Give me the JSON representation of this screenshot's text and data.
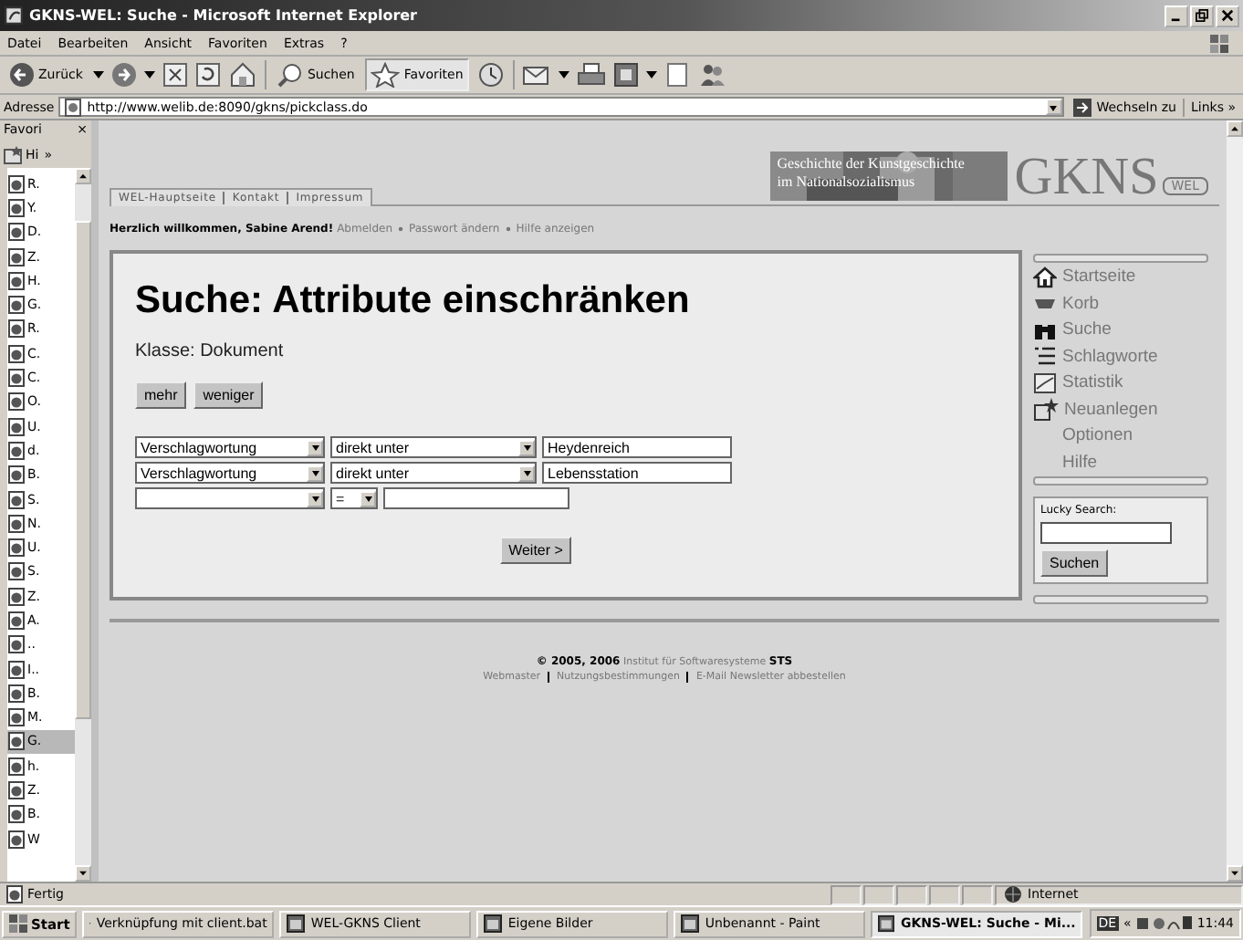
{
  "window": {
    "title": "GKNS-WEL: Suche - Microsoft Internet Explorer"
  },
  "menu": [
    "Datei",
    "Bearbeiten",
    "Ansicht",
    "Favoriten",
    "Extras",
    "?"
  ],
  "toolbar": {
    "back": "Zurück",
    "search": "Suchen",
    "favorites": "Favoriten"
  },
  "address": {
    "label": "Adresse",
    "url": "http://www.welib.de:8090/gkns/pickclass.do",
    "go": "Wechseln zu",
    "links": "Links »"
  },
  "favorites": {
    "title": "Favori",
    "close": "×",
    "add": "Hi",
    "more": "»",
    "items": [
      {
        "label": "R.",
        "selected": false
      },
      {
        "label": "Y.",
        "selected": false
      },
      {
        "label": "D.",
        "selected": false
      },
      {
        "label": "Z.",
        "selected": false
      },
      {
        "label": "H.",
        "selected": false
      },
      {
        "label": "G.",
        "selected": false
      },
      {
        "label": "R.",
        "selected": false
      },
      {
        "label": "C.",
        "selected": false
      },
      {
        "label": "C.",
        "selected": false
      },
      {
        "label": "O.",
        "selected": false
      },
      {
        "label": "U.",
        "selected": false
      },
      {
        "label": "d.",
        "selected": false
      },
      {
        "label": "B.",
        "selected": false
      },
      {
        "label": "S.",
        "selected": false
      },
      {
        "label": "N.",
        "selected": false
      },
      {
        "label": "U.",
        "selected": false
      },
      {
        "label": "S.",
        "selected": false
      },
      {
        "label": "Z.",
        "selected": false
      },
      {
        "label": "A.",
        "selected": false
      },
      {
        "label": "..",
        "selected": false
      },
      {
        "label": "I..",
        "selected": false
      },
      {
        "label": "B.",
        "selected": false
      },
      {
        "label": "M.",
        "selected": false
      },
      {
        "label": "G.",
        "selected": true
      },
      {
        "label": "h.",
        "selected": false
      },
      {
        "label": "Z.",
        "selected": false
      },
      {
        "label": "B.",
        "selected": false
      },
      {
        "label": "W",
        "selected": false
      }
    ]
  },
  "page": {
    "nav": [
      "WEL-Hauptseite",
      "Kontakt",
      "Impressum"
    ],
    "banner": [
      "Geschichte der Kunstgeschichte",
      "im Nationalsozialismus"
    ],
    "logo": {
      "main": "GKNS",
      "sub": "WEL"
    },
    "welcome": {
      "greeting": "Herzlich willkommen, Sabine Arend!",
      "links": [
        "Abmelden",
        "Passwort ändern",
        "Hilfe anzeigen"
      ]
    },
    "heading": "Suche: Attribute einschränken",
    "class_label": "Klasse: Dokument",
    "buttons": [
      "mehr",
      "weniger"
    ],
    "rows": [
      {
        "attribute": "Verschlagwortung",
        "relation": "direkt unter",
        "value": "Heydenreich",
        "kind": "wide"
      },
      {
        "attribute": "Verschlagwortung",
        "relation": "direkt unter",
        "value": "Lebensstation",
        "kind": "wide"
      },
      {
        "relation": "=",
        "kind": "narrow"
      }
    ],
    "submit": "Weiter >",
    "side_menu": [
      {
        "label": "Startseite",
        "kind": "home"
      },
      {
        "label": "Korb",
        "kind": "basket"
      },
      {
        "label": "Suche",
        "kind": "binoculars"
      },
      {
        "label": "Schlagworte",
        "kind": "list"
      },
      {
        "label": "Statistik",
        "kind": "chart"
      },
      {
        "label": "Neuanlegen",
        "kind": "new"
      },
      {
        "label": "Optionen",
        "kind": "none"
      },
      {
        "label": "Hilfe",
        "kind": "none"
      }
    ],
    "lucky": {
      "label": "Lucky Search:",
      "button": "Suchen"
    },
    "footer": {
      "copyright": "© 2005, 2006",
      "institute": "Institut für Softwaresysteme",
      "short": "STS",
      "links": [
        "Webmaster",
        "Nutzungsbestimmungen",
        "E-Mail Newsletter abbestellen"
      ]
    }
  },
  "status_bar": {
    "text": "Fertig",
    "zone": "Internet"
  },
  "taskbar": {
    "start": "Start",
    "tasks": [
      {
        "label": "Verknüpfung mit client.bat",
        "selected": false
      },
      {
        "label": "WEL-GKNS Client",
        "selected": false
      },
      {
        "label": "Eigene Bilder",
        "selected": false
      },
      {
        "label": "Unbenannt - Paint",
        "selected": false
      },
      {
        "label": "GKNS-WEL: Suche - Mi...",
        "selected": true
      }
    ],
    "lang": "DE",
    "expand": "«",
    "clock": "11:44"
  }
}
